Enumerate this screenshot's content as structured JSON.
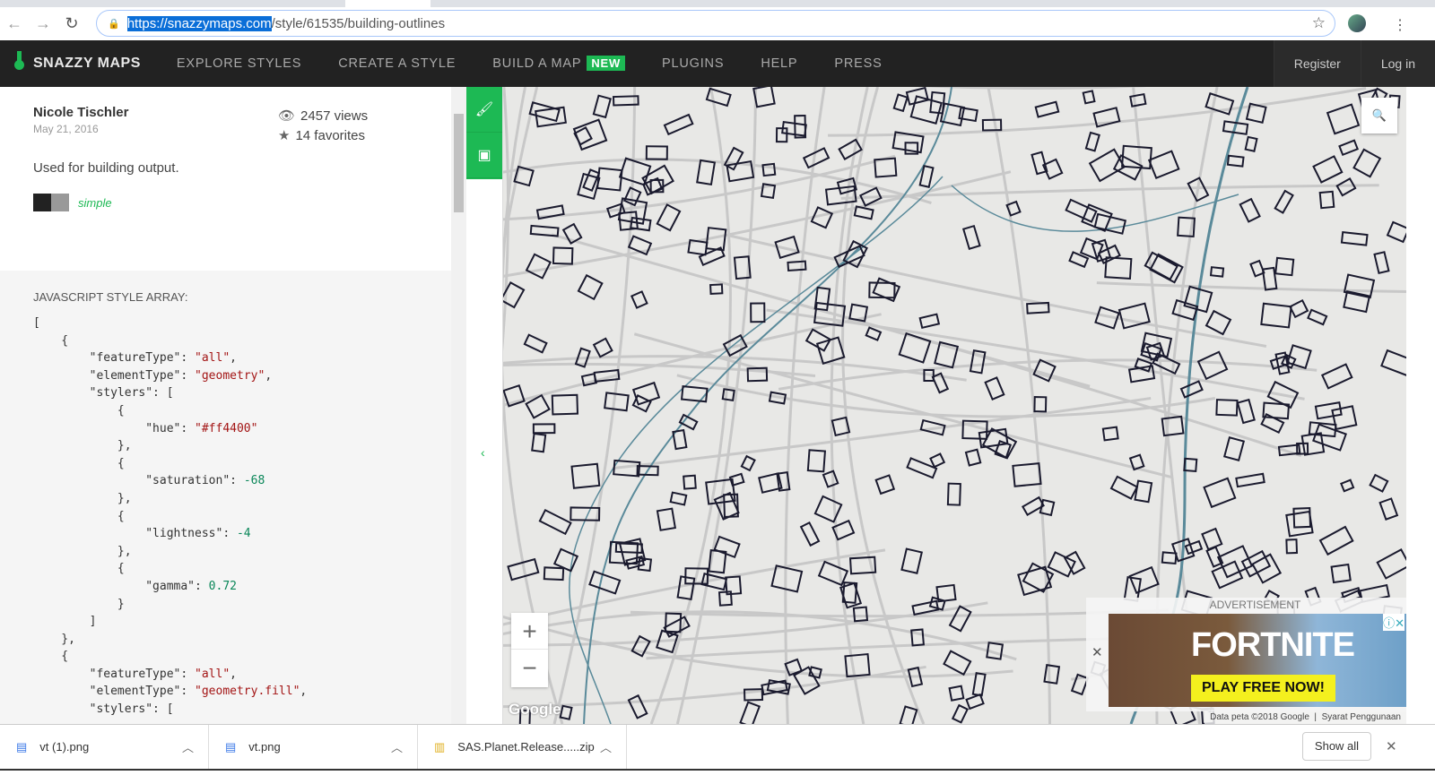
{
  "browser": {
    "url_highlight": "https://snazzymaps.com",
    "url_rest": "/style/61535/building-outlines"
  },
  "nav": {
    "brand": "SNAZZY MAPS",
    "links": [
      "EXPLORE STYLES",
      "CREATE A STYLE",
      "BUILD A MAP",
      "PLUGINS",
      "HELP",
      "PRESS"
    ],
    "new_badge": "NEW",
    "register": "Register",
    "login": "Log in"
  },
  "style_info": {
    "author": "Nicole Tischler",
    "date": "May 21, 2016",
    "views": "2457 views",
    "favorites": "14 favorites",
    "description": "Used for building output.",
    "tag": "simple",
    "colors": [
      "#222222",
      "#999999"
    ]
  },
  "json_section": {
    "heading": "JAVASCRIPT STYLE ARRAY:",
    "lines": [
      [
        [
          "p",
          "["
        ]
      ],
      [
        [
          "p",
          "    {"
        ]
      ],
      [
        [
          "p",
          "        "
        ],
        [
          "p",
          "\"featureType\": "
        ],
        [
          "s",
          "\"all\""
        ],
        [
          "p",
          ","
        ]
      ],
      [
        [
          "p",
          "        "
        ],
        [
          "p",
          "\"elementType\": "
        ],
        [
          "s",
          "\"geometry\""
        ],
        [
          "p",
          ","
        ]
      ],
      [
        [
          "p",
          "        \"stylers\": ["
        ]
      ],
      [
        [
          "p",
          "            {"
        ]
      ],
      [
        [
          "p",
          "                \"hue\": "
        ],
        [
          "s",
          "\"#ff4400\""
        ]
      ],
      [
        [
          "p",
          "            },"
        ]
      ],
      [
        [
          "p",
          "            {"
        ]
      ],
      [
        [
          "p",
          "                \"saturation\": "
        ],
        [
          "n",
          "-68"
        ]
      ],
      [
        [
          "p",
          "            },"
        ]
      ],
      [
        [
          "p",
          "            {"
        ]
      ],
      [
        [
          "p",
          "                \"lightness\": "
        ],
        [
          "n",
          "-4"
        ]
      ],
      [
        [
          "p",
          "            },"
        ]
      ],
      [
        [
          "p",
          "            {"
        ]
      ],
      [
        [
          "p",
          "                \"gamma\": "
        ],
        [
          "n",
          "0.72"
        ]
      ],
      [
        [
          "p",
          "            }"
        ]
      ],
      [
        [
          "p",
          "        ]"
        ]
      ],
      [
        [
          "p",
          "    },"
        ]
      ],
      [
        [
          "p",
          "    {"
        ]
      ],
      [
        [
          "p",
          "        \"featureType\": "
        ],
        [
          "s",
          "\"all\""
        ],
        [
          "p",
          ","
        ]
      ],
      [
        [
          "p",
          "        \"elementType\": "
        ],
        [
          "s",
          "\"geometry.fill\""
        ],
        [
          "p",
          ","
        ]
      ],
      [
        [
          "p",
          "        \"stylers\": ["
        ]
      ]
    ]
  },
  "map": {
    "google_logo": "Google",
    "attribution": "Data peta ©2018 Google",
    "terms": "Syarat Penggunaan",
    "zoom_in": "+",
    "zoom_out": "−",
    "colors": {
      "bg": "#e8e8e6",
      "road": "#c8c8c8",
      "water": "#5a8a9a",
      "building": "#1a1a2e"
    }
  },
  "ad": {
    "label": "ADVERTISEMENT",
    "title": "FORTNITE",
    "cta": "PLAY FREE NOW!"
  },
  "downloads": {
    "items": [
      "vt (1).png",
      "vt.png",
      "SAS.Planet.Release.....zip"
    ],
    "show_all": "Show all"
  }
}
